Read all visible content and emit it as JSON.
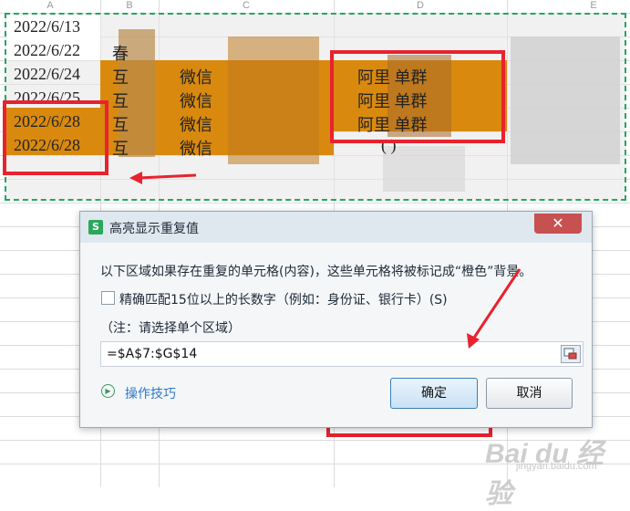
{
  "sheet": {
    "columns": [
      "A",
      "B",
      "C",
      "D",
      "E"
    ],
    "rows": [
      {
        "a": "2022/6/13",
        "b": "",
        "c": "",
        "d": ""
      },
      {
        "a": "2022/6/22",
        "b": "春",
        "c": "",
        "d": ""
      },
      {
        "a": "2022/6/24",
        "b": "互",
        "c": "微信",
        "d": "阿里  单群"
      },
      {
        "a": "2022/6/25",
        "b": "互",
        "c": "微信",
        "d": "阿里  单群"
      },
      {
        "a": "2022/6/28",
        "b": "互",
        "c": "微信",
        "d": "阿里  单群"
      },
      {
        "a": "2022/6/28",
        "b": "互",
        "c": "微信",
        "d": "(        )"
      }
    ],
    "highlight_color": "#d98a0e"
  },
  "dialog": {
    "title": "高亮显示重复值",
    "app_icon": "S",
    "close_symbol": "✕",
    "description": "以下区域如果存在重复的单元格(内容)，这些单元格将被标记成“橙色”背景。",
    "checkbox_label": "精确匹配15位以上的长数字（例如：身份证、银行卡）(S)",
    "checkbox_checked": false,
    "note": "（注：请选择单个区域）",
    "range_value": "=$A$7:$G$14",
    "tips_link": "操作技巧",
    "ok_label": "确定",
    "cancel_label": "取消"
  },
  "watermark": {
    "brand": "Bai du 经验",
    "url": "jingyan.baidu.com"
  },
  "colors": {
    "annotation_red": "#e8222e",
    "selection_green": "#27a564"
  }
}
